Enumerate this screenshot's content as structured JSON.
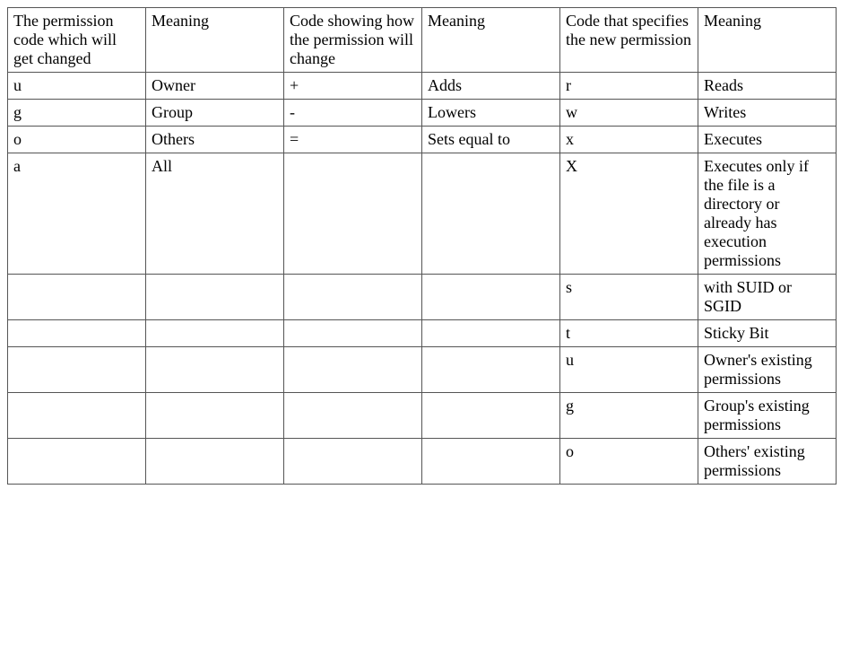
{
  "table": {
    "headers": [
      "The permission code which will get changed",
      "Meaning",
      "Code showing how\nthe permission will change",
      "Meaning",
      "Code that specifies the new permission",
      "Meaning"
    ],
    "rows": [
      [
        "u",
        "Owner",
        "+",
        "Adds",
        "r",
        "Reads"
      ],
      [
        "g",
        "Group",
        "-",
        "Lowers",
        "w",
        "Writes"
      ],
      [
        "o",
        "Others",
        "=",
        "Sets equal to",
        "x",
        "Executes"
      ],
      [
        "a",
        "All",
        "",
        "",
        "X",
        "Executes only if the file is a directory or already has execution permissions"
      ],
      [
        "",
        "",
        "",
        "",
        "s",
        "with SUID or SGID"
      ],
      [
        "",
        "",
        "",
        "",
        "t",
        "Sticky Bit"
      ],
      [
        "",
        "",
        "",
        "",
        "u",
        "Owner's existing permissions"
      ],
      [
        "",
        "",
        "",
        "",
        "g",
        "Group's existing permissions"
      ],
      [
        "",
        "",
        "",
        "",
        "o",
        "Others' existing permissions"
      ]
    ]
  }
}
